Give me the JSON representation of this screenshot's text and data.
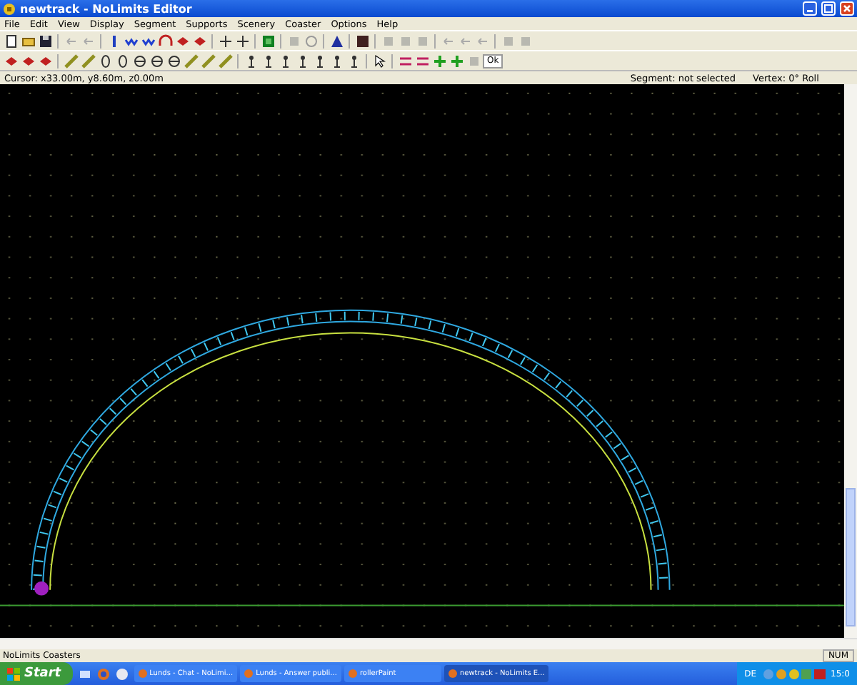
{
  "window": {
    "title": "newtrack - NoLimits Editor"
  },
  "menu": [
    "File",
    "Edit",
    "View",
    "Display",
    "Segment",
    "Supports",
    "Scenery",
    "Coaster",
    "Options",
    "Help"
  ],
  "toolbar": {
    "button": "Ok"
  },
  "info_bar": {
    "cursor": "Cursor: x33.00m, y8.60m, z0.00m",
    "segment": "Segment: not selected",
    "vertex": "Vertex: 0° Roll"
  },
  "status_bar": {
    "text": "NoLimits Coasters",
    "num": "NUM"
  },
  "taskbar": {
    "start": "Start",
    "tasks": [
      {
        "label": "Lunds - Chat - NoLimi...",
        "selected": false
      },
      {
        "label": "Lunds - Answer publi...",
        "selected": false
      },
      {
        "label": "rollerPaint",
        "selected": false
      },
      {
        "label": "newtrack - NoLimits E...",
        "selected": true
      }
    ],
    "language": "DE",
    "clock": "15:0"
  }
}
